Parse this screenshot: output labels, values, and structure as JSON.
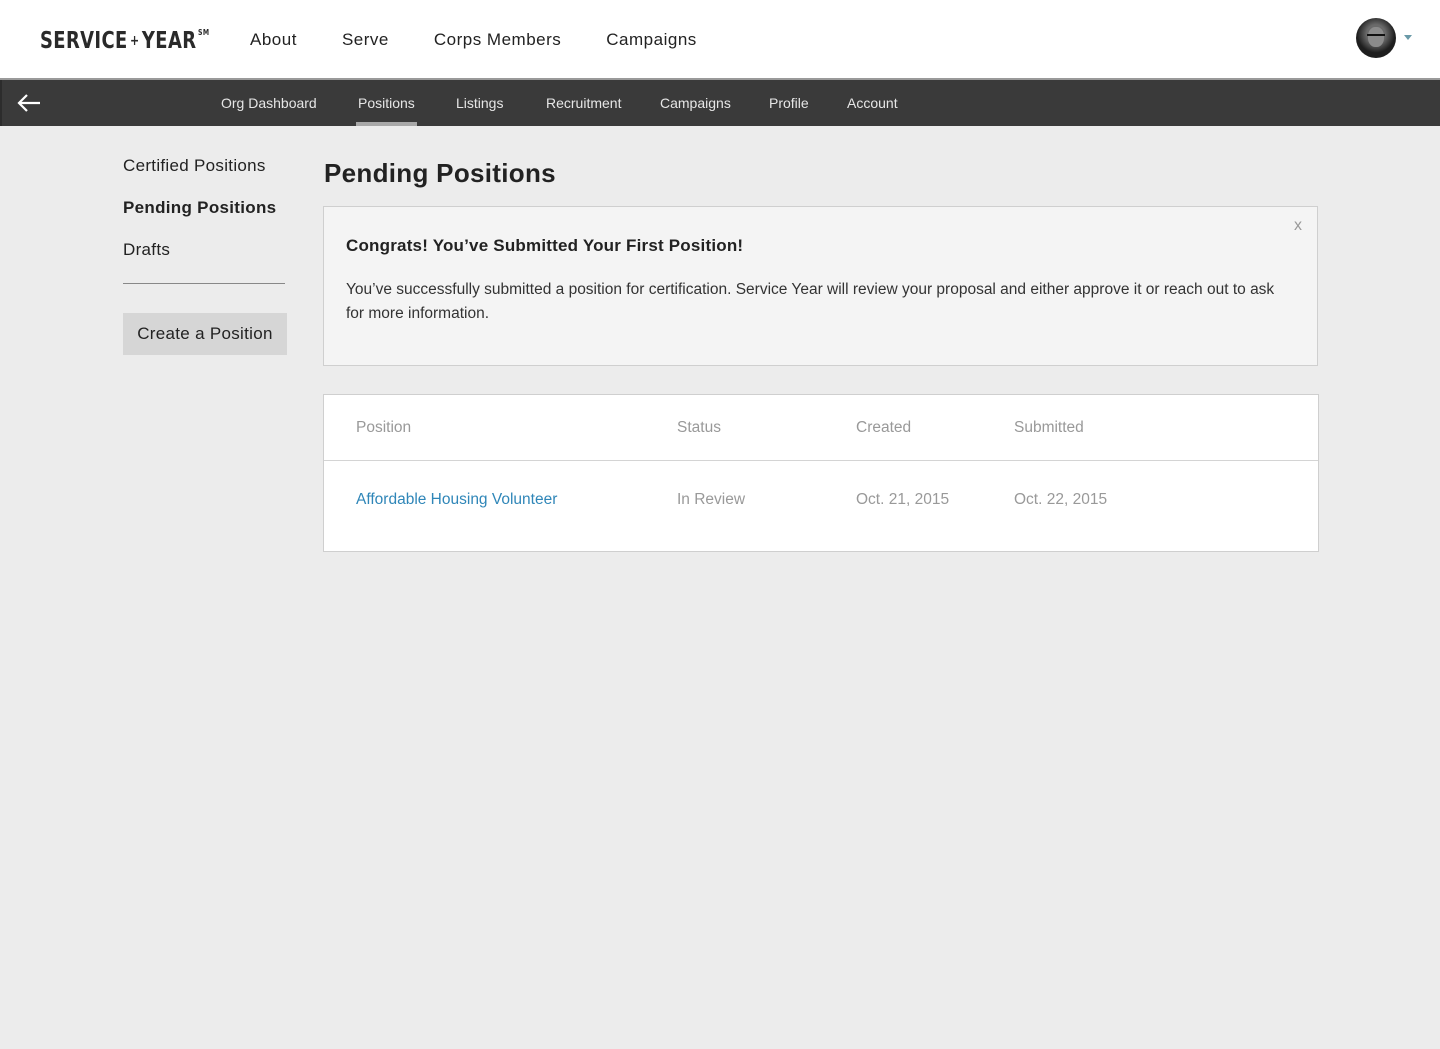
{
  "header": {
    "logo_left": "SERVICE",
    "logo_plus": "+",
    "logo_right": "YEAR",
    "logo_mark": "SM",
    "nav": [
      "About",
      "Serve",
      "Corps Members",
      "Campaigns"
    ],
    "avatar_icon": "user-avatar",
    "caret_icon": "caret-down-icon"
  },
  "subnav": {
    "back_icon": "arrow-left-icon",
    "items": [
      "Org Dashboard",
      "Positions",
      "Listings",
      "Recruitment",
      "Campaigns",
      "Profile",
      "Account"
    ],
    "active": "Positions"
  },
  "sidebar": {
    "links": [
      "Certified Positions",
      "Pending Positions",
      "Drafts"
    ],
    "active": "Pending Positions",
    "create_label": "Create a Position"
  },
  "main": {
    "title": "Pending Positions",
    "alert": {
      "title": "Congrats! You’ve Submitted Your First Position!",
      "body": "You’ve successfully submitted a position for certification. Service Year will review your proposal and either approve it or reach out to ask for more information.",
      "close": "x"
    },
    "table": {
      "headers": [
        "Position",
        "Status",
        "Created",
        "Submitted"
      ],
      "rows": [
        [
          "Affordable Housing Volunteer",
          "In Review",
          "Oct. 21, 2015",
          "Oct. 22, 2015"
        ]
      ]
    }
  },
  "colors": {
    "subnav_bg": "#3a3a3a",
    "page_bg": "#ececec",
    "link": "#2f86b8"
  }
}
